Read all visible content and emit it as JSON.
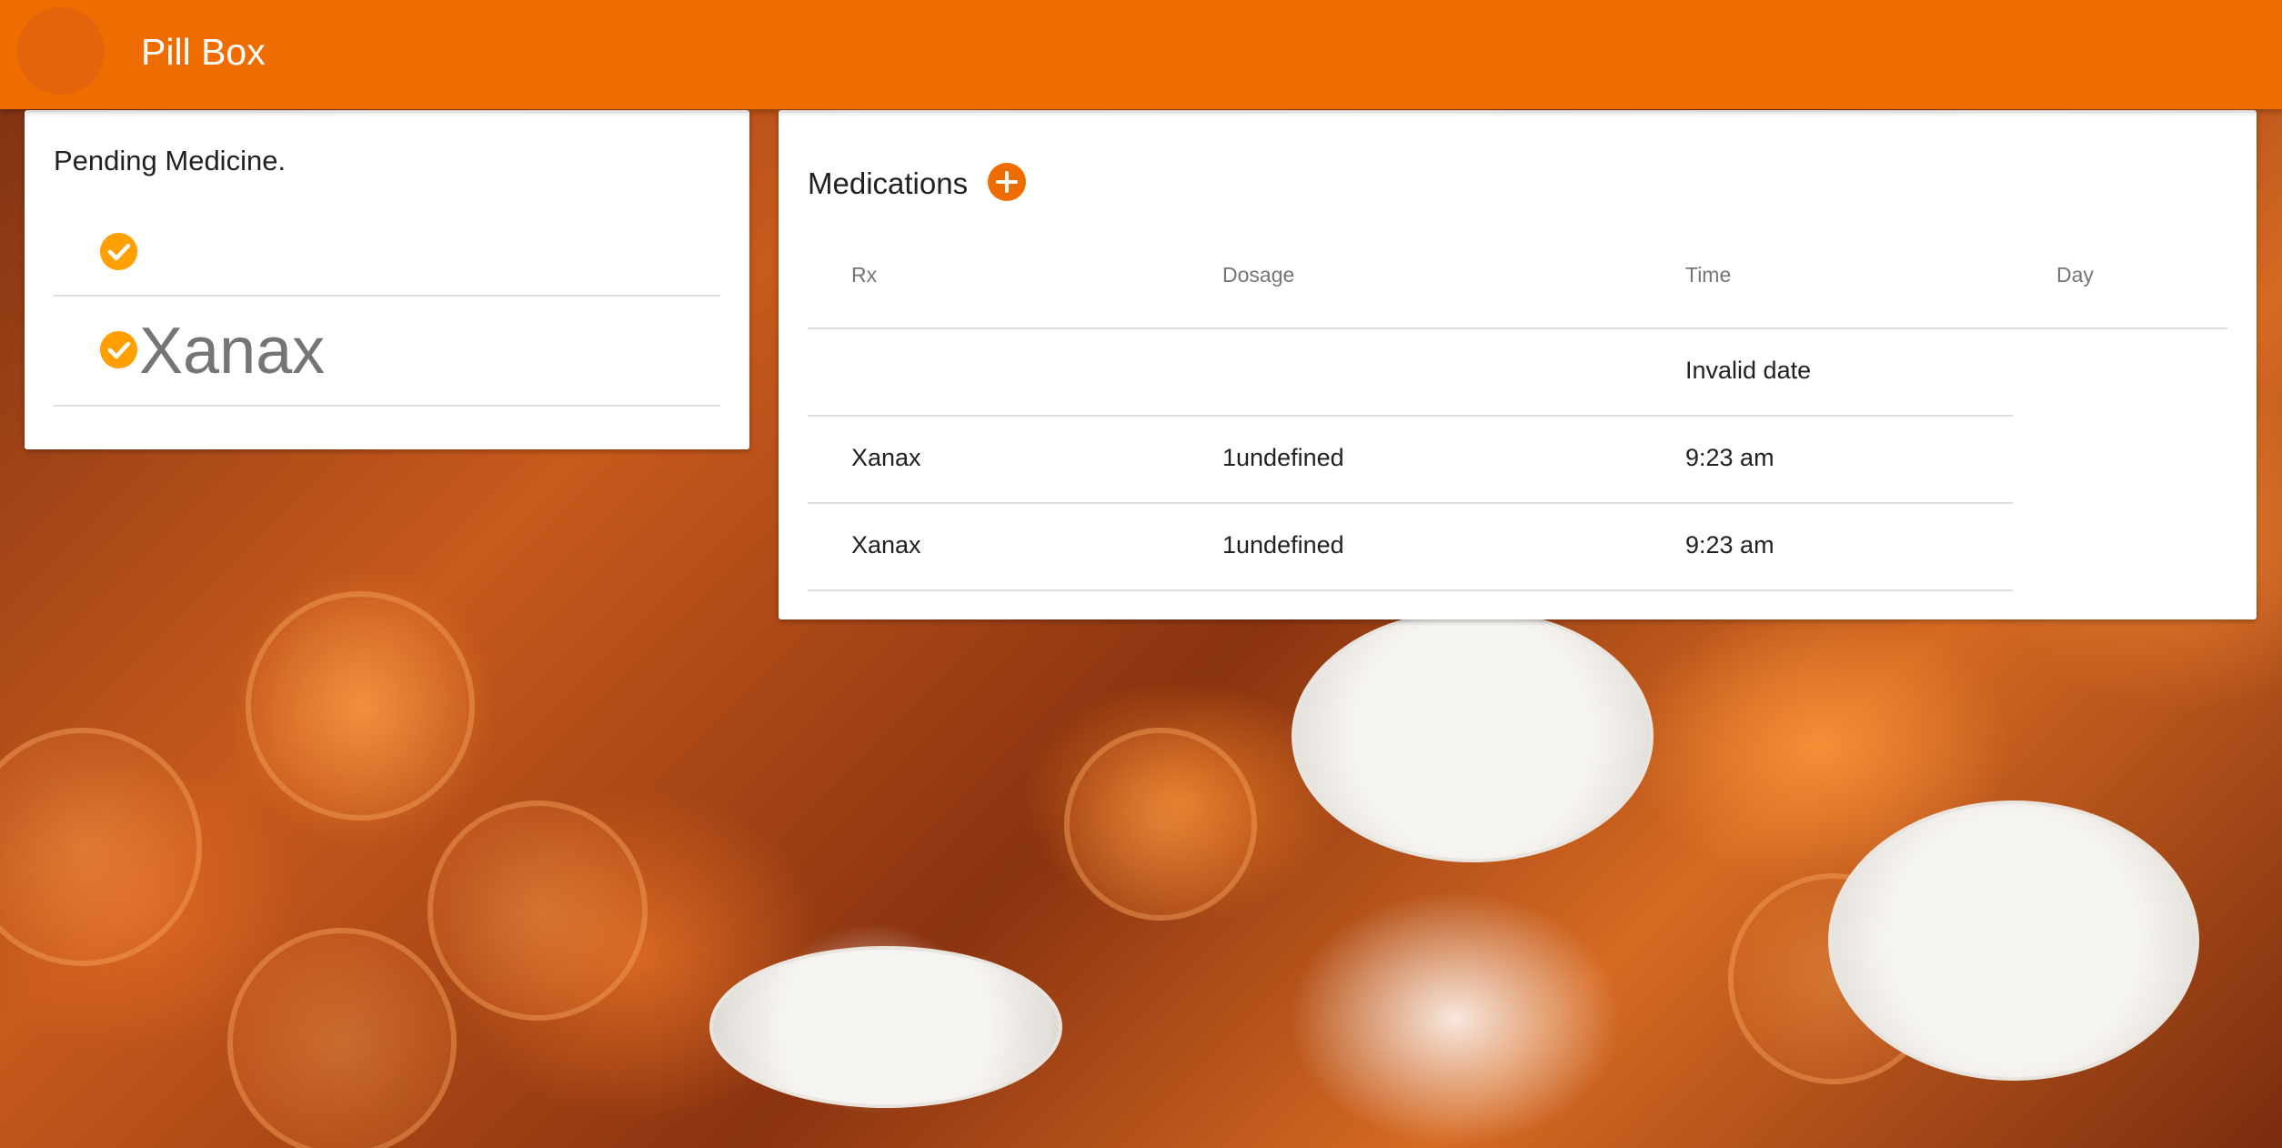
{
  "app": {
    "title": "Pill Box"
  },
  "pending": {
    "title": "Pending Medicine.",
    "items": [
      {
        "name": ""
      },
      {
        "name": "Xanax"
      }
    ]
  },
  "medications": {
    "title": "Medications",
    "columns": {
      "rx": "Rx",
      "dosage": "Dosage",
      "time": "Time",
      "day": "Day"
    },
    "rows": [
      {
        "rx": "",
        "dosage": "",
        "time": "Invalid date"
      },
      {
        "rx": "Xanax",
        "dosage": "1undefined",
        "time": "9:23 am"
      },
      {
        "rx": "Xanax",
        "dosage": "1undefined",
        "time": "9:23 am"
      }
    ]
  },
  "colors": {
    "primary": "#ef6c00",
    "accent": "#ffa000"
  },
  "icons": {
    "check": "check-circle-icon",
    "add": "add-circle-icon"
  }
}
